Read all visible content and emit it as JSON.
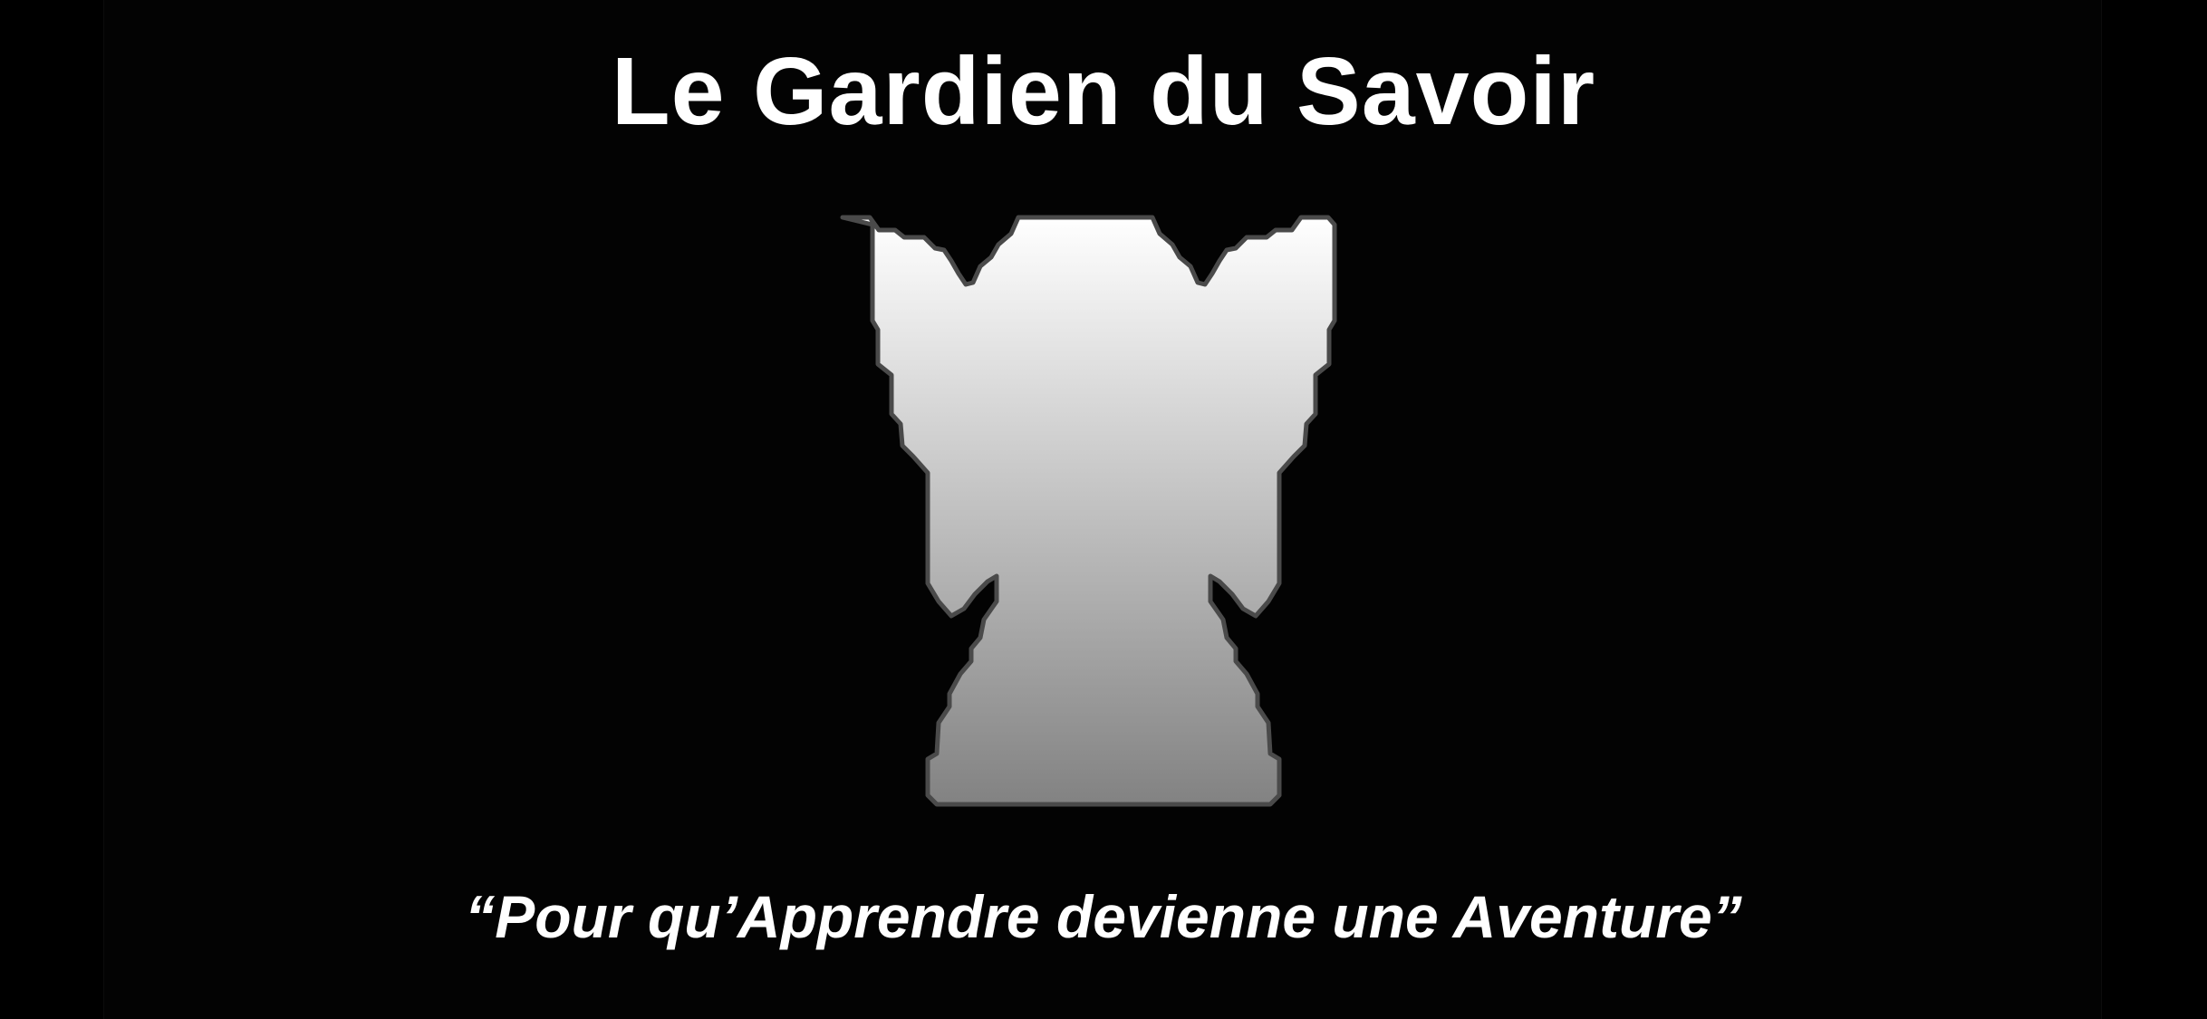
{
  "splash": {
    "title": "Le Gardien du Savoir",
    "tagline": "“Pour qu’Apprendre devienne une Aventure”",
    "emblem_icon": "guardian-silhouette-icon"
  },
  "colors": {
    "background": "#000000",
    "text": "#ffffff",
    "emblem_top": "#ffffff",
    "emblem_bottom": "#828282",
    "emblem_outline": "#4a4a4a"
  }
}
